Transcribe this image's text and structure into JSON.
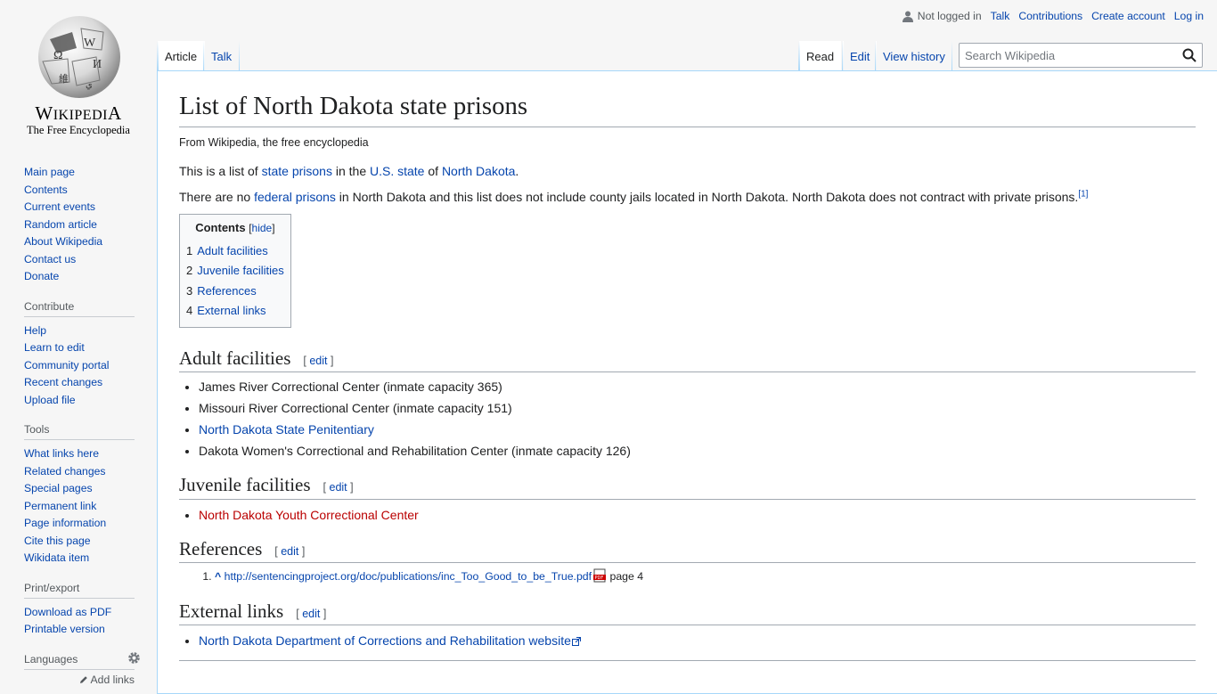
{
  "logo": {
    "wordmark": "Wikipedia",
    "tagline": "The Free Encyclopedia",
    "icon": "wikipedia-globe-icon"
  },
  "personal": {
    "not_logged_in": "Not logged in",
    "talk": "Talk",
    "contributions": "Contributions",
    "create_account": "Create account",
    "log_in": "Log in"
  },
  "tabs": {
    "article": "Article",
    "talk": "Talk",
    "read": "Read",
    "edit": "Edit",
    "view_history": "View history"
  },
  "search": {
    "placeholder": "Search Wikipedia"
  },
  "sidebar": {
    "navigation": [
      "Main page",
      "Contents",
      "Current events",
      "Random article",
      "About Wikipedia",
      "Contact us",
      "Donate"
    ],
    "contribute": {
      "heading": "Contribute",
      "items": [
        "Help",
        "Learn to edit",
        "Community portal",
        "Recent changes",
        "Upload file"
      ]
    },
    "tools": {
      "heading": "Tools",
      "items": [
        "What links here",
        "Related changes",
        "Special pages",
        "Permanent link",
        "Page information",
        "Cite this page",
        "Wikidata item"
      ]
    },
    "print": {
      "heading": "Print/export",
      "items": [
        "Download as PDF",
        "Printable version"
      ]
    },
    "languages": {
      "heading": "Languages",
      "add_links": "Add links"
    }
  },
  "article": {
    "title": "List of North Dakota state prisons",
    "sitesub": "From Wikipedia, the free encyclopedia",
    "intro": {
      "t1": "This is a list of ",
      "l1": "state prisons",
      "t2": " in the ",
      "l2": "U.S. state",
      "t3": " of ",
      "l3": "North Dakota",
      "t4": "."
    },
    "para2": {
      "t1": "There are no ",
      "l1": "federal prisons",
      "t2": " in North Dakota and this list does not include county jails located in North Dakota. North Dakota does not contract with private prisons.",
      "ref": "[1]"
    },
    "toc": {
      "title": "Contents",
      "toggle": "hide",
      "items": [
        {
          "num": "1",
          "label": "Adult facilities"
        },
        {
          "num": "2",
          "label": "Juvenile facilities"
        },
        {
          "num": "3",
          "label": "References"
        },
        {
          "num": "4",
          "label": "External links"
        }
      ]
    },
    "edit_label": "edit",
    "sections": {
      "adult": {
        "heading": "Adult facilities",
        "items": [
          "James River Correctional Center (inmate capacity 365)",
          "Missouri River Correctional Center (inmate capacity 151)",
          "North Dakota State Penitentiary",
          "Dakota Women's Correctional and Rehabilitation Center (inmate capacity 126)"
        ]
      },
      "juvenile": {
        "heading": "Juvenile facilities",
        "items": [
          "North Dakota Youth Correctional Center"
        ]
      },
      "references": {
        "heading": "References",
        "caret": "^",
        "url": "http://sentencingproject.org/doc/publications/inc_Too_Good_to_be_True.pdf",
        "suffix": " page 4"
      },
      "external": {
        "heading": "External links",
        "items": [
          "North Dakota Department of Corrections and Rehabilitation website"
        ]
      }
    }
  },
  "colors": {
    "link": "#0645ad",
    "redlink": "#ba0000",
    "border": "#a2a9b1",
    "tab_border": "#a7d7f9"
  }
}
